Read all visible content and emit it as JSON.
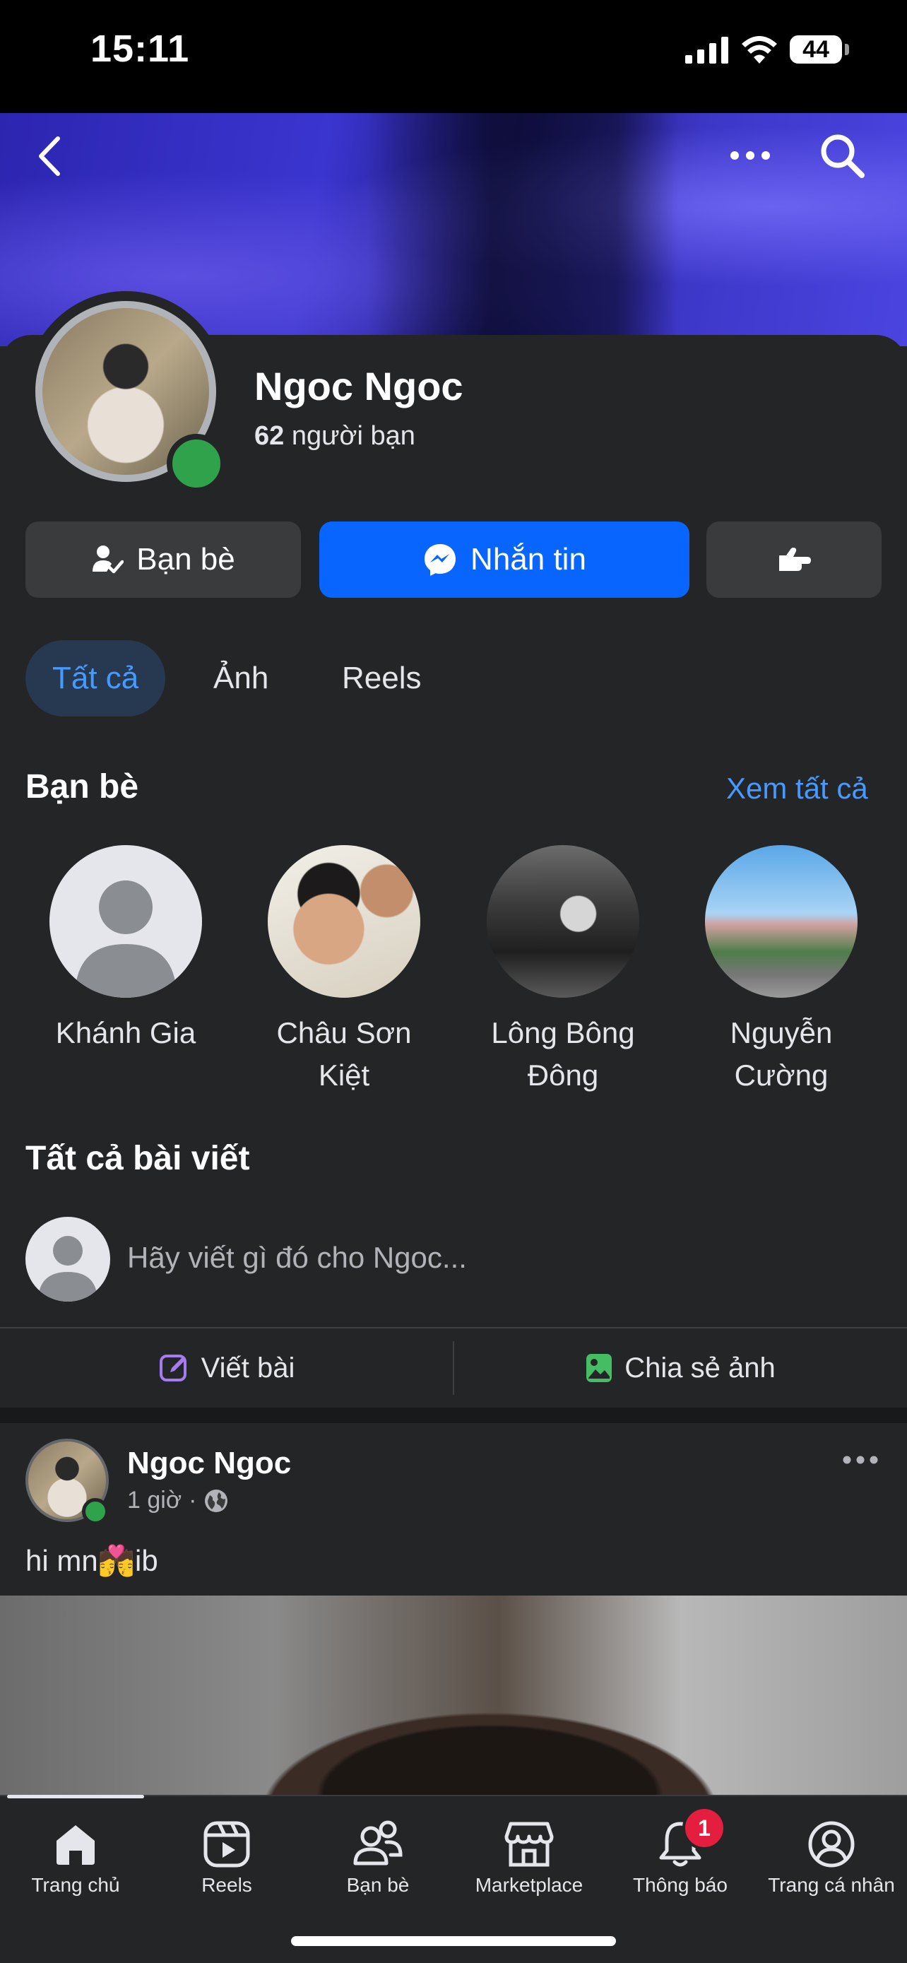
{
  "status_bar": {
    "time": "15:11",
    "battery": "44"
  },
  "profile": {
    "name": "Ngoc Ngoc",
    "friend_count": "62",
    "friend_suffix": "người bạn"
  },
  "actions": {
    "friends_label": "Bạn bè",
    "message_label": "Nhắn tin"
  },
  "tabs": [
    {
      "label": "Tất cả",
      "active": true
    },
    {
      "label": "Ảnh"
    },
    {
      "label": "Reels"
    }
  ],
  "friends_section": {
    "title": "Bạn bè",
    "see_all": "Xem tất cả",
    "friends": [
      {
        "name": "Khánh Gia"
      },
      {
        "name": "Châu Sơn Kiệt"
      },
      {
        "name": "Lông Bông Đông"
      },
      {
        "name": "Nguyễn Cường"
      }
    ]
  },
  "posts_section": {
    "title": "Tất cả bài viết",
    "composer_placeholder": "Hãy viết gì đó cho Ngoc...",
    "write_post": "Viết bài",
    "share_photo": "Chia sẻ ảnh"
  },
  "post": {
    "author": "Ngoc Ngoc",
    "time": "1 giờ",
    "separator": "·",
    "text_before": "hi mn",
    "emoji": "💏",
    "text_after": "ib"
  },
  "bottom_nav": [
    {
      "label": "Trang chủ",
      "icon": "home-icon",
      "active": true
    },
    {
      "label": "Reels",
      "icon": "reels-icon"
    },
    {
      "label": "Bạn bè",
      "icon": "friends-icon"
    },
    {
      "label": "Marketplace",
      "icon": "marketplace-icon"
    },
    {
      "label": "Thông báo",
      "icon": "bell-icon",
      "badge": "1"
    },
    {
      "label": "Trang cá nhân",
      "icon": "profile-icon"
    }
  ],
  "colors": {
    "accent": "#0866ff",
    "link": "#4599ff",
    "online": "#31a24c",
    "badge": "#e41e3f",
    "background": "#242526"
  }
}
